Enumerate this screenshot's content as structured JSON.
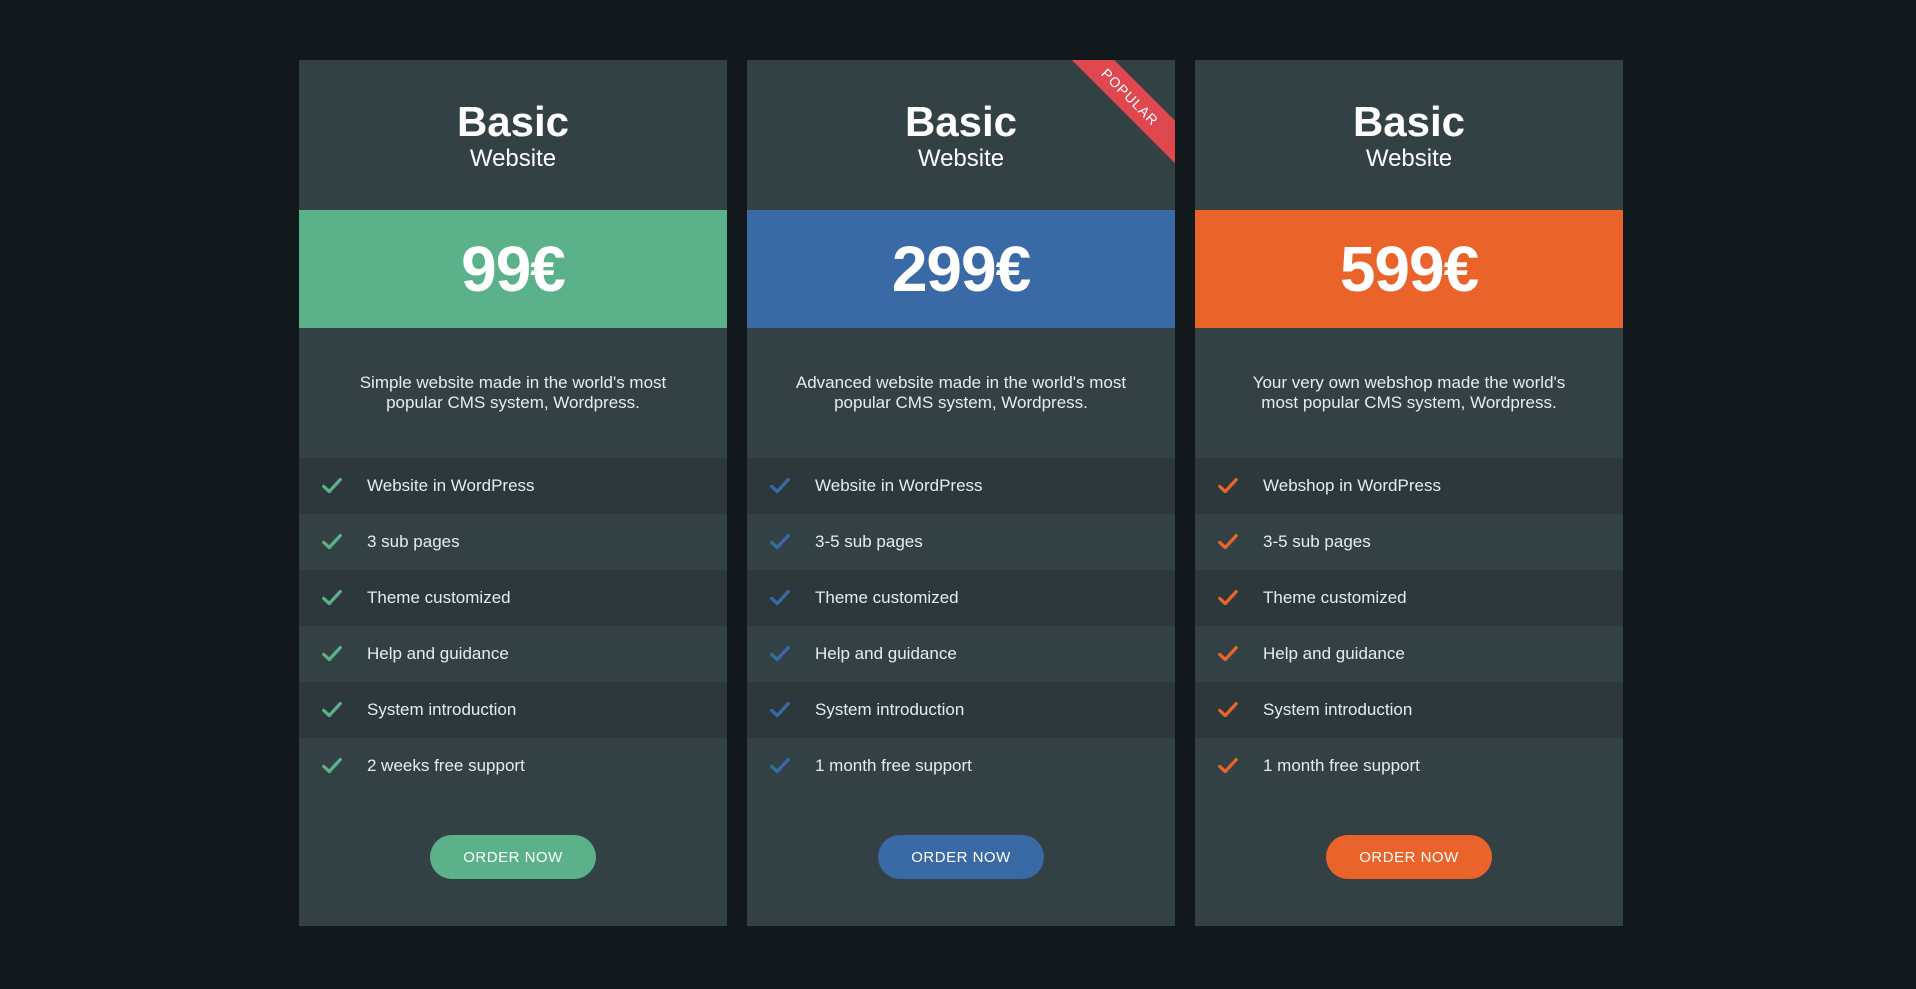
{
  "cards": [
    {
      "title": "Basic",
      "subtitle": "Website",
      "price": "99€",
      "accent": "#5bb28a",
      "description": "Simple website made in the world's most popular CMS system, Wordpress.",
      "features": [
        "Website in WordPress",
        "3 sub pages",
        "Theme customized",
        "Help and guidance",
        "System introduction",
        "2 weeks free support"
      ],
      "button_label": "ORDER NOW"
    },
    {
      "title": "Basic",
      "subtitle": "Website",
      "price": "299€",
      "accent": "#3a6aa6",
      "ribbon": "POPULAR",
      "ribbon_color": "#e04850",
      "description": "Advanced website made in the world's most popular CMS system, Wordpress.",
      "features": [
        "Website in WordPress",
        "3-5 sub pages",
        "Theme customized",
        "Help and guidance",
        "System introduction",
        "1 month free support"
      ],
      "button_label": "ORDER NOW"
    },
    {
      "title": "Basic",
      "subtitle": "Website",
      "price": "599€",
      "accent": "#ea632a",
      "description": "Your very own webshop made the world's most popular CMS system, Wordpress.",
      "features": [
        "Webshop in WordPress",
        "3-5 sub pages",
        "Theme customized",
        "Help and guidance",
        "System introduction",
        "1 month free support"
      ],
      "button_label": "ORDER NOW"
    }
  ],
  "icons": {
    "feature": "check-icon"
  }
}
